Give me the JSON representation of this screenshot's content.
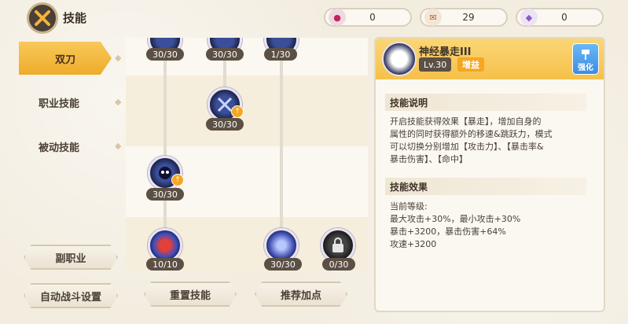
{
  "header": {
    "title": "技能",
    "currencies": [
      {
        "icon": "red-gem-icon",
        "value": "0"
      },
      {
        "icon": "scroll-icon",
        "value": "29"
      },
      {
        "icon": "purple-crystal-icon",
        "value": "0"
      }
    ]
  },
  "nav": {
    "items": [
      {
        "label": "双刀",
        "active": true
      },
      {
        "label": "职业技能",
        "active": false
      },
      {
        "label": "被动技能",
        "active": false
      }
    ]
  },
  "side_buttons": {
    "sub_class": "副职业",
    "auto_battle": "自动战斗设置"
  },
  "tree_buttons": {
    "reset": "重置技能",
    "recommend": "推荐加点"
  },
  "skills": [
    {
      "level": "30/30"
    },
    {
      "level": "30/30"
    },
    {
      "level": "1/30"
    },
    {
      "level": "30/30"
    },
    {
      "level": "30/30"
    },
    {
      "level": "10/10"
    },
    {
      "level": "30/30"
    },
    {
      "level": "0/30"
    }
  ],
  "detail": {
    "name": "神经暴走III",
    "level": "Lv.30",
    "tag": "增益",
    "enhance_label": "强化",
    "desc_title": "技能说明",
    "desc_lines": [
      "开启技能获得效果【暴走】，增加自身的",
      "属性的同时获得额外的移速&跳跃力，模式",
      "可以切换分别增加【攻击力】、【暴击率&",
      "暴击伤害】、【命中】"
    ],
    "effect_title": "技能效果",
    "effect_lines": [
      "当前等级:",
      "最大攻击+30%，最小攻击+30%",
      "暴击+3200，暴击伤害+64%",
      "攻速+3200"
    ]
  },
  "colors": {
    "accent": "#f5a623",
    "active_nav": "#f0b53a",
    "enhance_blue": "#3a8de3"
  }
}
